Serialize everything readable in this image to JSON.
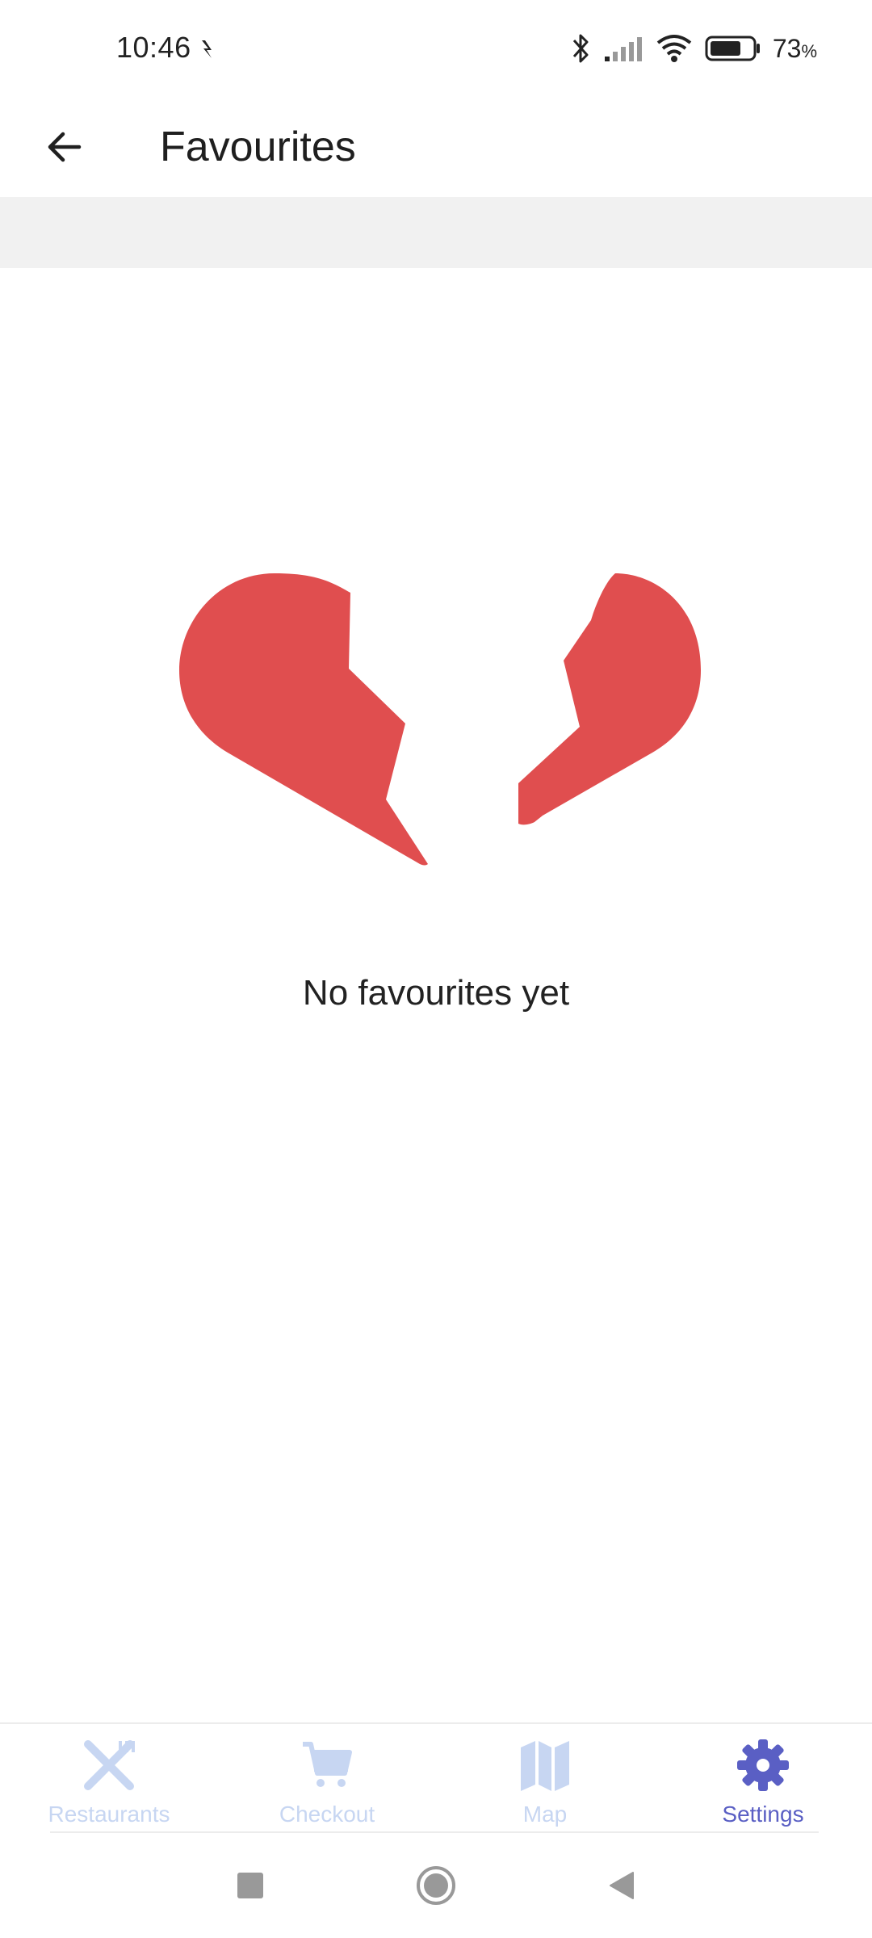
{
  "status_bar": {
    "time": "10:46",
    "battery_percent": "73",
    "battery_unit": "%",
    "battery_level": 0.73,
    "icons": [
      "bluetooth-icon",
      "signal-icon",
      "wifi-icon",
      "battery-icon"
    ]
  },
  "toolbar": {
    "title": "Favourites",
    "back_icon": "arrow-left-icon"
  },
  "empty_state": {
    "message": "No favourites yet",
    "icon": "broken-heart-icon",
    "icon_color": "#e04e4f"
  },
  "bottom_nav": {
    "items": [
      {
        "label": "Restaurants",
        "icon": "fork-knife-icon",
        "active": false
      },
      {
        "label": "Checkout",
        "icon": "cart-icon",
        "active": false
      },
      {
        "label": "Map",
        "icon": "map-icon",
        "active": false
      },
      {
        "label": "Settings",
        "icon": "gear-icon",
        "active": true
      }
    ],
    "inactive_color": "#c7d6f2",
    "active_color": "#5a5fc4"
  },
  "system_nav": {
    "buttons": [
      "recents-button",
      "home-button",
      "back-button"
    ]
  }
}
